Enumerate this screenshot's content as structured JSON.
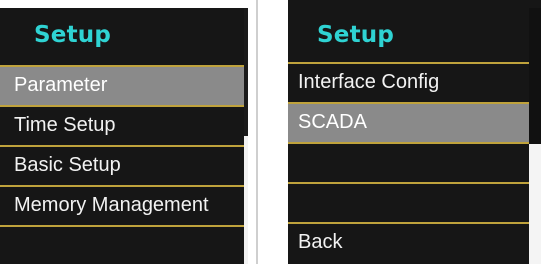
{
  "left_screen": {
    "title": "Setup",
    "items": [
      {
        "label": "Parameter",
        "selected": true
      },
      {
        "label": "Time Setup",
        "selected": false
      },
      {
        "label": "Basic Setup",
        "selected": false
      },
      {
        "label": "Memory Management",
        "selected": false
      },
      {
        "label": "",
        "selected": false
      }
    ]
  },
  "right_screen": {
    "title": "Setup",
    "items": [
      {
        "label": "Interface Config",
        "selected": false
      },
      {
        "label": "SCADA",
        "selected": true
      },
      {
        "label": "",
        "selected": false
      },
      {
        "label": "",
        "selected": false
      },
      {
        "label": "Back",
        "selected": false
      }
    ]
  },
  "colors": {
    "title": "#2fd3d3",
    "separator": "#bfa23c",
    "background": "#161616",
    "highlight": "#8a8a8a"
  }
}
